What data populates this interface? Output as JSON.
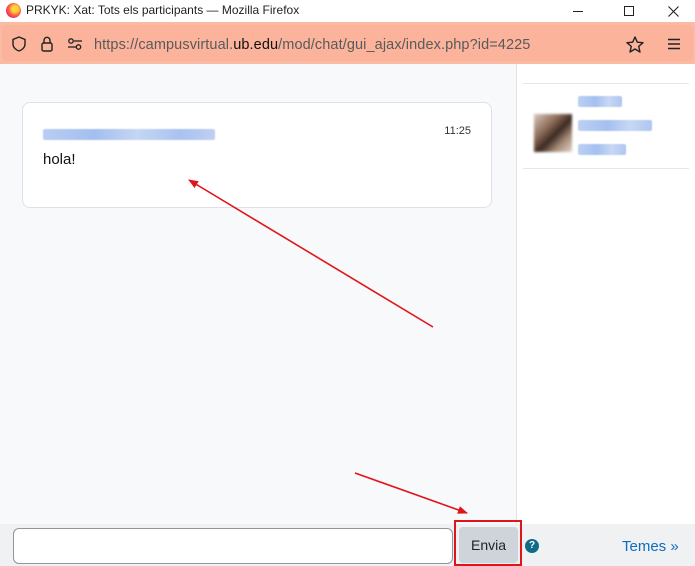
{
  "window": {
    "title": "PRKYK: Xat: Tots els participants — Mozilla Firefox"
  },
  "browser": {
    "url_prefix": "https://campusvirtual.",
    "url_domain": "ub.edu",
    "url_path": "/mod/chat/gui_ajax/index.php?id=4225",
    "accent_color": "#fbbba2"
  },
  "chat": {
    "messages": [
      {
        "time": "11:25",
        "text": "hola!"
      }
    ],
    "input": {
      "value": "",
      "placeholder": ""
    },
    "send_label": "Envia",
    "help_label": "?",
    "themes_label": "Temes »"
  },
  "annotations": {
    "color": "#e0141b"
  }
}
